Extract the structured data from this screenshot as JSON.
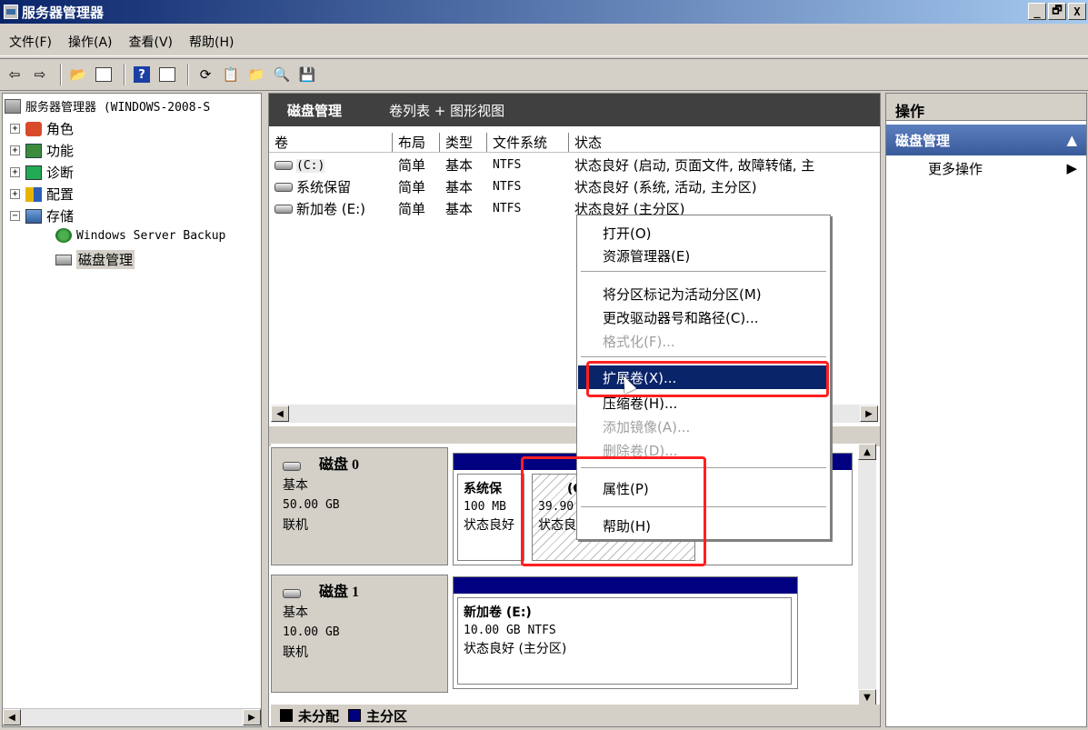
{
  "window": {
    "title": "服务器管理器",
    "min": "_",
    "max": "🗗",
    "close": "X"
  },
  "menu": [
    "文件(F)",
    "操作(A)",
    "查看(V)",
    "帮助(H)"
  ],
  "tree": {
    "root": "服务器管理器 (WINDOWS-2008-S",
    "roles": "角色",
    "features": "功能",
    "diagnostics": "诊断",
    "configuration": "配置",
    "storage": "存储",
    "backup": "Windows Server Backup",
    "diskmgmt": "磁盘管理"
  },
  "center": {
    "title": "磁盘管理",
    "view": "卷列表 + 图形视图",
    "columns": [
      "卷",
      "布局",
      "类型",
      "文件系统",
      "状态"
    ],
    "volumes": [
      {
        "name": "(C:)",
        "layout": "简单",
        "type": "基本",
        "fs": "NTFS",
        "status": "状态良好 (启动, 页面文件, 故障转储, 主"
      },
      {
        "name": "系统保留",
        "layout": "简单",
        "type": "基本",
        "fs": "NTFS",
        "status": "状态良好 (系统, 活动, 主分区)"
      },
      {
        "name": "新加卷 (E:)",
        "layout": "简单",
        "type": "基本",
        "fs": "NTFS",
        "status": "状态良好 (主分区)"
      }
    ]
  },
  "disks": [
    {
      "name": "磁盘 0",
      "kind": "基本",
      "size": "50.00 GB",
      "state": "联机",
      "partitions": [
        {
          "name": "系统保",
          "size": "100 MB",
          "status": "状态良好"
        },
        {
          "name": "(C",
          "size": "39.90",
          "status": "状态良"
        }
      ]
    },
    {
      "name": "磁盘 1",
      "kind": "基本",
      "size": "10.00 GB",
      "state": "联机",
      "partitions": [
        {
          "name": "新加卷  (E:)",
          "size": "10.00 GB NTFS",
          "status": "状态良好 (主分区)"
        }
      ]
    }
  ],
  "legend": {
    "unallocated": "未分配",
    "primary": "主分区"
  },
  "actions": {
    "header": "操作",
    "section": "磁盘管理",
    "more": "更多操作"
  },
  "context_menu": {
    "open": "打开(O)",
    "explorer": "资源管理器(E)",
    "mark_active": "将分区标记为活动分区(M)",
    "change_letter": "更改驱动器号和路径(C)...",
    "format": "格式化(F)...",
    "extend": "扩展卷(X)...",
    "shrink": "压缩卷(H)...",
    "add_mirror": "添加镜像(A)...",
    "delete": "删除卷(D)...",
    "properties": "属性(P)",
    "help": "帮助(H)"
  },
  "colors": {
    "selection": "#0a246a",
    "primary_partition": "#000080",
    "highlight": "#ff2020"
  }
}
